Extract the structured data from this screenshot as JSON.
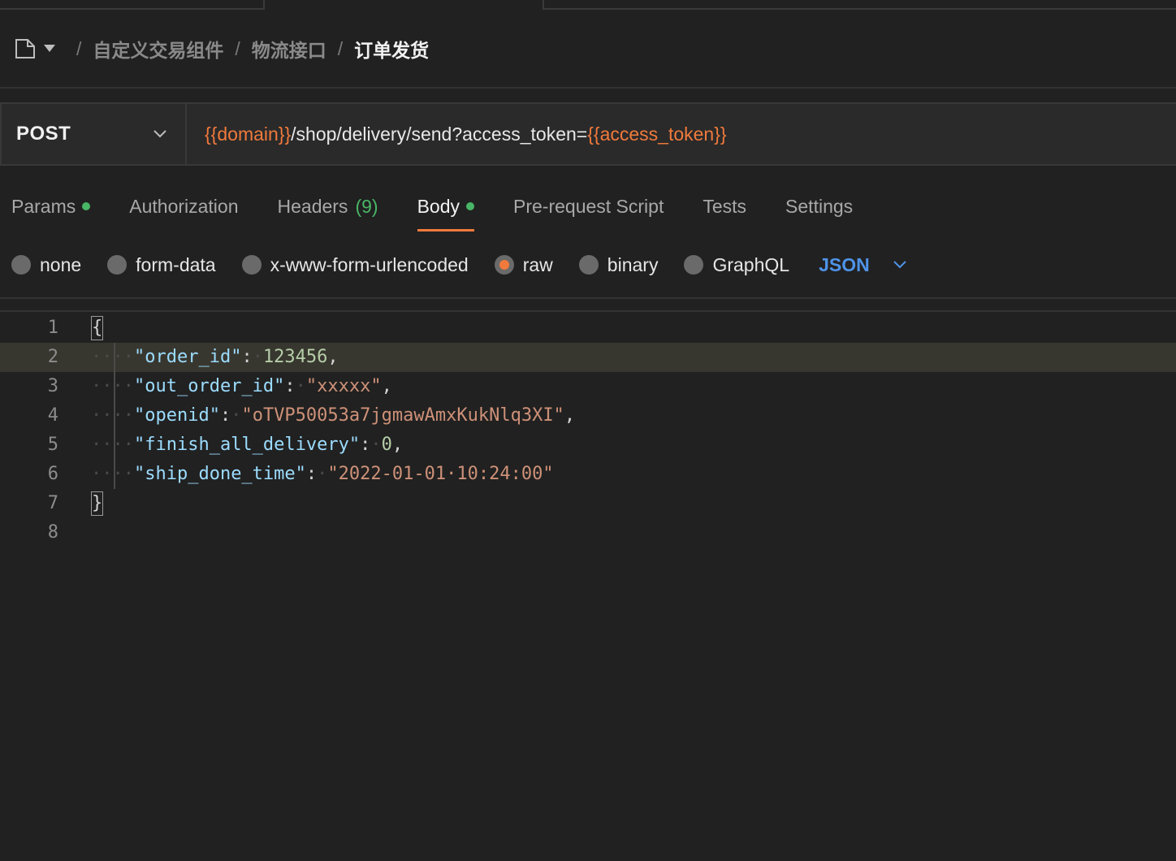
{
  "breadcrumb": {
    "items": [
      "自定义交易组件",
      "物流接口"
    ],
    "current": "订单发货",
    "separator": "/"
  },
  "request": {
    "method": "POST",
    "url_parts": [
      {
        "text": "{{domain}}",
        "var": true
      },
      {
        "text": "/shop/delivery/send?access_token=",
        "var": false
      },
      {
        "text": "{{access_token}}",
        "var": true
      }
    ]
  },
  "tabs": [
    {
      "label": "Params",
      "dot": true
    },
    {
      "label": "Authorization"
    },
    {
      "label": "Headers",
      "count": "(9)"
    },
    {
      "label": "Body",
      "dot": true,
      "active": true
    },
    {
      "label": "Pre-request Script"
    },
    {
      "label": "Tests"
    },
    {
      "label": "Settings"
    }
  ],
  "body_types": [
    {
      "label": "none",
      "selected": false
    },
    {
      "label": "form-data",
      "selected": false
    },
    {
      "label": "x-www-form-urlencoded",
      "selected": false
    },
    {
      "label": "raw",
      "selected": true
    },
    {
      "label": "binary",
      "selected": false
    },
    {
      "label": "GraphQL",
      "selected": false
    }
  ],
  "language": "JSON",
  "editor": {
    "highlighted_line": 2,
    "lines": [
      {
        "n": "1",
        "tokens": [
          [
            "brace",
            "{"
          ]
        ]
      },
      {
        "n": "2",
        "tokens": [
          [
            "k",
            "\"order_id\""
          ],
          [
            "p",
            ":"
          ],
          [
            "ws",
            "·"
          ],
          [
            "n",
            "123456"
          ],
          [
            "p",
            ","
          ]
        ]
      },
      {
        "n": "3",
        "tokens": [
          [
            "k",
            "\"out_order_id\""
          ],
          [
            "p",
            ":"
          ],
          [
            "ws",
            "·"
          ],
          [
            "s",
            "\"xxxxx\""
          ],
          [
            "p",
            ","
          ]
        ]
      },
      {
        "n": "4",
        "tokens": [
          [
            "k",
            "\"openid\""
          ],
          [
            "p",
            ":"
          ],
          [
            "ws",
            "·"
          ],
          [
            "s",
            "\"oTVP50053a7jgmawAmxKukNlq3XI\""
          ],
          [
            "p",
            ","
          ]
        ]
      },
      {
        "n": "5",
        "tokens": [
          [
            "k",
            "\"finish_all_delivery\""
          ],
          [
            "p",
            ":"
          ],
          [
            "ws",
            "·"
          ],
          [
            "n",
            "0"
          ],
          [
            "p",
            ","
          ]
        ]
      },
      {
        "n": "6",
        "tokens": [
          [
            "k",
            "\"ship_done_time\""
          ],
          [
            "p",
            ":"
          ],
          [
            "ws",
            "·"
          ],
          [
            "s",
            "\"2022-01-01·10:24:00\""
          ]
        ]
      },
      {
        "n": "7",
        "tokens": [
          [
            "brace",
            "}"
          ]
        ]
      },
      {
        "n": "8",
        "tokens": []
      }
    ]
  },
  "colors": {
    "accent": "#f07a3c",
    "success": "#49b566",
    "link": "#4e93e8",
    "background": "#212121"
  }
}
